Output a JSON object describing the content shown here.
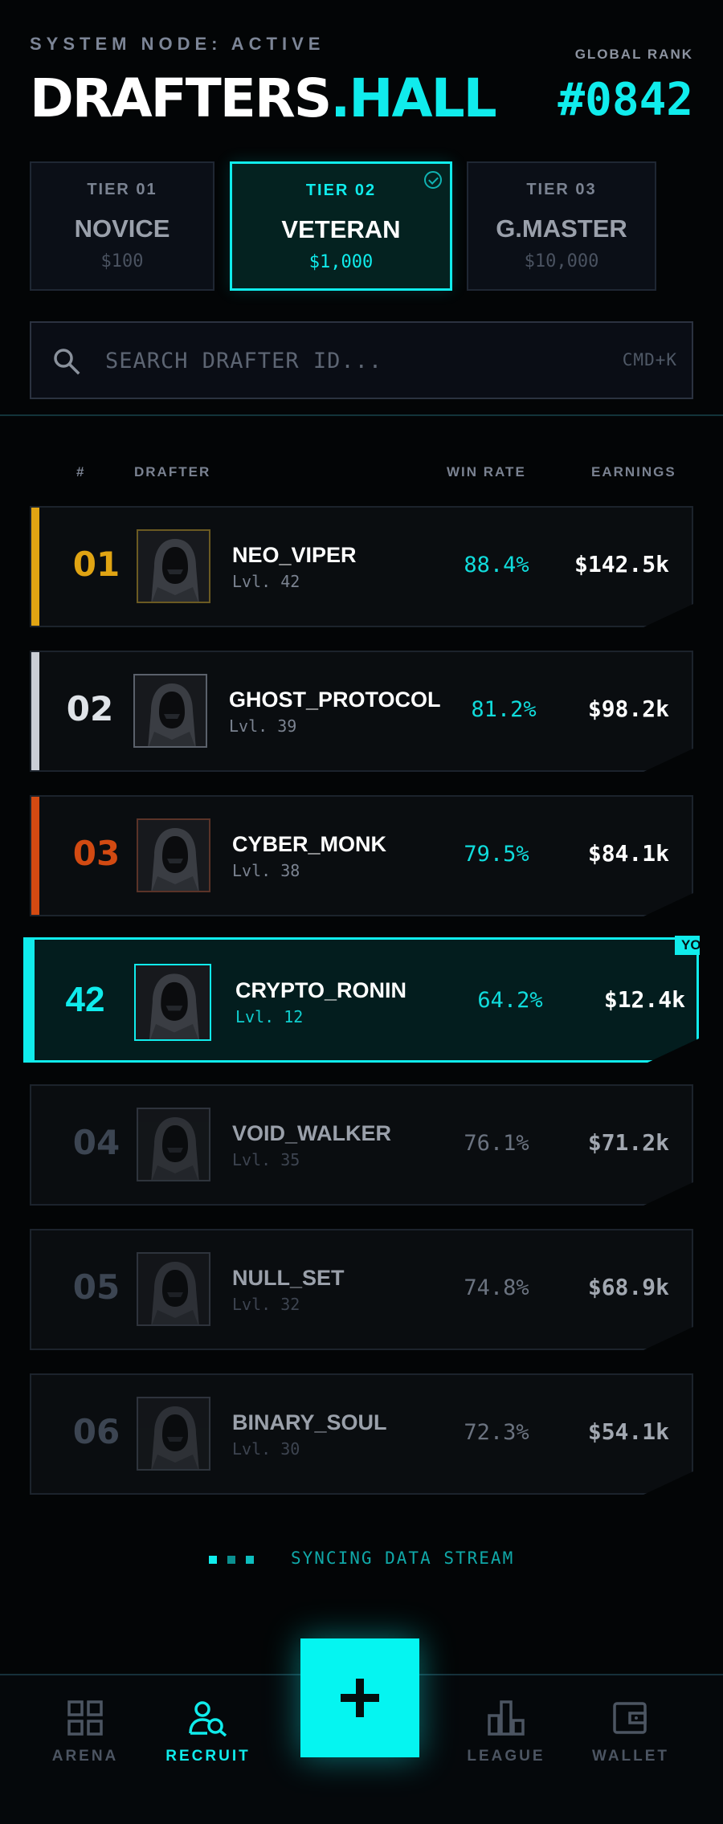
{
  "header": {
    "system_status": "SYSTEM NODE: ACTIVE",
    "brand_main": "DRAFTERS",
    "brand_accent": ".HALL",
    "global_rank_label": "GLOBAL RANK",
    "global_rank_value": "#0842"
  },
  "tiers": [
    {
      "label": "TIER 01",
      "name": "NOVICE",
      "price": "$100",
      "selected": false
    },
    {
      "label": "TIER 02",
      "name": "VETERAN",
      "price": "$1,000",
      "selected": true
    },
    {
      "label": "TIER 03",
      "name": "G.MASTER",
      "price": "$10,000",
      "selected": false
    }
  ],
  "search": {
    "placeholder": "SEARCH DRAFTER ID...",
    "value": "",
    "shortcut": "CMD+K"
  },
  "table": {
    "headers": {
      "rank": "#",
      "drafter": "DRAFTER",
      "win_rate": "WIN RATE",
      "earnings": "EARNINGS"
    },
    "rows": [
      {
        "rank": "01",
        "name": "NEO_VIPER",
        "level": "Lvl. 42",
        "win_rate": "88.4%",
        "earnings": "$142.5k",
        "accent": "#e0a413"
      },
      {
        "rank": "02",
        "name": "GHOST_PROTOCOL",
        "level": "Lvl. 39",
        "win_rate": "81.2%",
        "earnings": "$98.2k",
        "accent": "#c9ced6"
      },
      {
        "rank": "03",
        "name": "CYBER_MONK",
        "level": "Lvl. 38",
        "win_rate": "79.5%",
        "earnings": "$84.1k",
        "accent": "#d24a12"
      },
      {
        "rank": "04",
        "name": "VOID_WALKER",
        "level": "Lvl. 35",
        "win_rate": "76.1%",
        "earnings": "$71.2k"
      },
      {
        "rank": "05",
        "name": "NULL_SET",
        "level": "Lvl. 32",
        "win_rate": "74.8%",
        "earnings": "$68.9k"
      },
      {
        "rank": "06",
        "name": "BINARY_SOUL",
        "level": "Lvl. 30",
        "win_rate": "72.3%",
        "earnings": "$54.1k"
      }
    ],
    "you": {
      "rank": "42",
      "name": "CRYPTO_RONIN",
      "level": "Lvl. 12",
      "win_rate": "64.2%",
      "earnings": "$12.4k",
      "badge": "YOU"
    }
  },
  "sync": {
    "label": "SYNCING DATA STREAM"
  },
  "nav": {
    "items": [
      {
        "label": "ARENA",
        "icon": "grid-icon"
      },
      {
        "label": "RECRUIT",
        "icon": "user-search-icon",
        "active": true
      },
      {
        "label": "LEAGUE",
        "icon": "bar-chart-icon"
      },
      {
        "label": "WALLET",
        "icon": "wallet-icon"
      }
    ],
    "fab_icon": "plus-icon"
  },
  "colors": {
    "accent": "#10ecec",
    "background": "#030506",
    "gold": "#e0a413",
    "silver": "#c9ced6",
    "bronze": "#d24a12"
  }
}
